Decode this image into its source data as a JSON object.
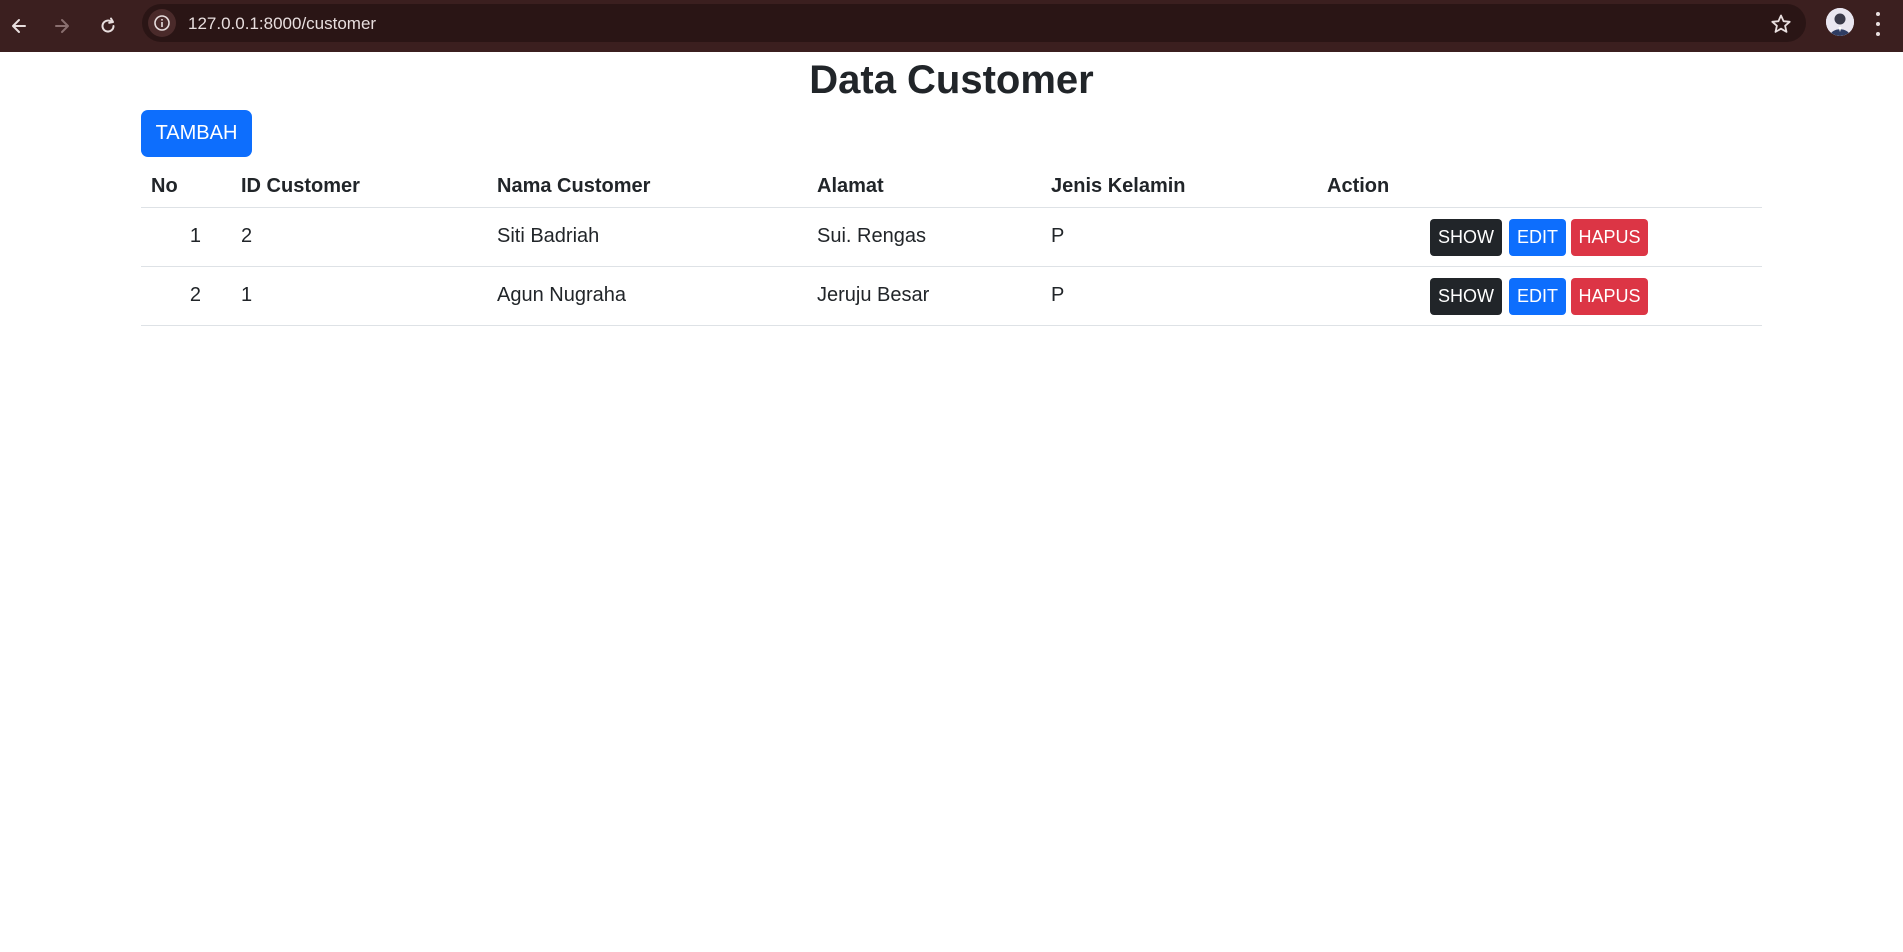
{
  "browser": {
    "url": "127.0.0.1:8000/customer",
    "icons": [
      "back-arrow-icon",
      "forward-arrow-icon",
      "reload-icon",
      "site-info-icon",
      "star-icon",
      "profile-avatar",
      "kebab-menu-icon"
    ]
  },
  "page": {
    "title": "Data Customer",
    "add_button_label": "TAMBAH"
  },
  "table": {
    "headers": {
      "no": "No",
      "id": "ID Customer",
      "nama": "Nama Customer",
      "alamat": "Alamat",
      "jk": "Jenis Kelamin",
      "action": "Action"
    },
    "rows": [
      {
        "no": "1",
        "id": "2",
        "nama": "Siti Badriah",
        "alamat": "Sui. Rengas",
        "jk": "P"
      },
      {
        "no": "2",
        "id": "1",
        "nama": "Agun Nugraha",
        "alamat": "Jeruju Besar",
        "jk": "P"
      }
    ],
    "action_labels": {
      "show": "SHOW",
      "edit": "EDIT",
      "hapus": "HAPUS"
    }
  },
  "colors": {
    "chrome_bg": "#3b1f1f",
    "primary": "#0d6efd",
    "dark": "#212529",
    "danger": "#dc3545"
  }
}
